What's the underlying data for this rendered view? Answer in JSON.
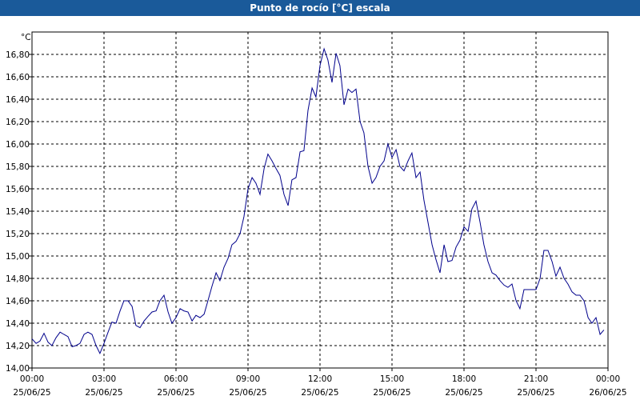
{
  "window": {
    "title": "Punto de rocío [°C] escala"
  },
  "chart_data": {
    "type": "line",
    "title": "Punto de rocío [°C] escala",
    "ylabel": "°C",
    "xlabel": "",
    "ylim": [
      14.0,
      17.0
    ],
    "y_ticks": [
      "14,00",
      "14,20",
      "14,40",
      "14,60",
      "14,80",
      "15,00",
      "15,20",
      "15,40",
      "15,60",
      "15,80",
      "16,00",
      "16,20",
      "16,40",
      "16,60",
      "16,80"
    ],
    "x_ticks": [
      {
        "time": "00:00",
        "date": "25/06/25"
      },
      {
        "time": "03:00",
        "date": "25/06/25"
      },
      {
        "time": "06:00",
        "date": "25/06/25"
      },
      {
        "time": "09:00",
        "date": "25/06/25"
      },
      {
        "time": "12:00",
        "date": "25/06/25"
      },
      {
        "time": "15:00",
        "date": "25/06/25"
      },
      {
        "time": "18:00",
        "date": "25/06/25"
      },
      {
        "time": "21:00",
        "date": "25/06/25"
      },
      {
        "time": "00:00",
        "date": "26/06/25"
      }
    ],
    "grid": true,
    "line_color": "#00008b",
    "series": [
      {
        "x": [
          0,
          0.17,
          0.33,
          0.5,
          0.67,
          0.83,
          1,
          1.17,
          1.33,
          1.5,
          1.67,
          1.83,
          2,
          2.17,
          2.33,
          2.5,
          2.67,
          2.83,
          3,
          3.17,
          3.33,
          3.5,
          3.67,
          3.83,
          4,
          4.17,
          4.33,
          4.5,
          4.67,
          4.83,
          5,
          5.17,
          5.33,
          5.5,
          5.67,
          5.83,
          6,
          6.17,
          6.33,
          6.5,
          6.67,
          6.83,
          7,
          7.17,
          7.33,
          7.5,
          7.67,
          7.83,
          8,
          8.17,
          8.33,
          8.5,
          8.67,
          8.83,
          9,
          9.17,
          9.33,
          9.5,
          9.67,
          9.83,
          10,
          10.17,
          10.33,
          10.5,
          10.67,
          10.83,
          11,
          11.17,
          11.33,
          11.5,
          11.67,
          11.83,
          12,
          12.17,
          12.33,
          12.5,
          12.67,
          12.83,
          13,
          13.17,
          13.33,
          13.5,
          13.67,
          13.83,
          14,
          14.17,
          14.33,
          14.5,
          14.67,
          14.83,
          15,
          15.17,
          15.33,
          15.5,
          15.67,
          15.83,
          16,
          16.17,
          16.33,
          16.5,
          16.67,
          16.83,
          17,
          17.17,
          17.33,
          17.5,
          17.67,
          17.83,
          18,
          18.17,
          18.33,
          18.5,
          18.67,
          18.83,
          19,
          19.17,
          19.33,
          19.5,
          19.67,
          19.83,
          20,
          20.17,
          20.33,
          20.5,
          20.67,
          20.83,
          21,
          21.17,
          21.33,
          21.5,
          21.67,
          21.83,
          22,
          22.17,
          22.33,
          22.5,
          22.67,
          22.83,
          23,
          23.17,
          23.33,
          23.5,
          23.67,
          23.83
        ],
        "values": [
          14.26,
          14.22,
          14.24,
          14.31,
          14.23,
          14.2,
          14.27,
          14.32,
          14.3,
          14.28,
          14.19,
          14.2,
          14.22,
          14.3,
          14.32,
          14.3,
          14.2,
          14.13,
          14.22,
          14.32,
          14.41,
          14.4,
          14.51,
          14.6,
          14.6,
          14.55,
          14.38,
          14.36,
          14.42,
          14.46,
          14.5,
          14.51,
          14.6,
          14.65,
          14.5,
          14.4,
          14.45,
          14.53,
          14.51,
          14.5,
          14.42,
          14.47,
          14.45,
          14.48,
          14.6,
          14.73,
          14.85,
          14.78,
          14.9,
          14.98,
          15.1,
          15.13,
          15.2,
          15.35,
          15.6,
          15.7,
          15.65,
          15.55,
          15.78,
          15.91,
          15.85,
          15.78,
          15.72,
          15.55,
          15.45,
          15.68,
          15.7,
          15.93,
          15.94,
          16.3,
          16.5,
          16.42,
          16.7,
          16.85,
          16.75,
          16.55,
          16.81,
          16.7,
          16.35,
          16.49,
          16.46,
          16.49,
          16.2,
          16.1,
          15.8,
          15.65,
          15.7,
          15.8,
          15.85,
          16.0,
          15.88,
          15.95,
          15.8,
          15.76,
          15.85,
          15.92,
          15.7,
          15.75,
          15.5,
          15.3,
          15.1,
          14.97,
          14.85,
          15.1,
          14.95,
          14.96,
          15.08,
          15.14,
          15.26,
          15.22,
          15.42,
          15.49,
          15.3,
          15.1,
          14.95,
          14.85,
          14.83,
          14.78,
          14.74,
          14.72,
          14.75,
          14.6,
          14.53,
          14.7,
          14.7,
          14.7,
          14.7,
          14.8,
          15.05,
          15.05,
          14.95,
          14.82,
          14.9,
          14.8,
          14.75,
          14.68,
          14.65,
          14.65,
          14.6,
          14.45,
          14.4,
          14.45,
          14.3,
          14.34
        ]
      }
    ]
  }
}
